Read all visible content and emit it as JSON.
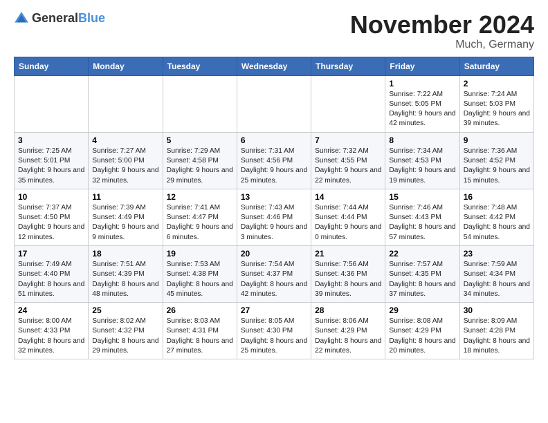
{
  "logo": {
    "general": "General",
    "blue": "Blue"
  },
  "title": "November 2024",
  "location": "Much, Germany",
  "weekdays": [
    "Sunday",
    "Monday",
    "Tuesday",
    "Wednesday",
    "Thursday",
    "Friday",
    "Saturday"
  ],
  "weeks": [
    [
      {
        "day": "",
        "info": ""
      },
      {
        "day": "",
        "info": ""
      },
      {
        "day": "",
        "info": ""
      },
      {
        "day": "",
        "info": ""
      },
      {
        "day": "",
        "info": ""
      },
      {
        "day": "1",
        "info": "Sunrise: 7:22 AM\nSunset: 5:05 PM\nDaylight: 9 hours and 42 minutes."
      },
      {
        "day": "2",
        "info": "Sunrise: 7:24 AM\nSunset: 5:03 PM\nDaylight: 9 hours and 39 minutes."
      }
    ],
    [
      {
        "day": "3",
        "info": "Sunrise: 7:25 AM\nSunset: 5:01 PM\nDaylight: 9 hours and 35 minutes."
      },
      {
        "day": "4",
        "info": "Sunrise: 7:27 AM\nSunset: 5:00 PM\nDaylight: 9 hours and 32 minutes."
      },
      {
        "day": "5",
        "info": "Sunrise: 7:29 AM\nSunset: 4:58 PM\nDaylight: 9 hours and 29 minutes."
      },
      {
        "day": "6",
        "info": "Sunrise: 7:31 AM\nSunset: 4:56 PM\nDaylight: 9 hours and 25 minutes."
      },
      {
        "day": "7",
        "info": "Sunrise: 7:32 AM\nSunset: 4:55 PM\nDaylight: 9 hours and 22 minutes."
      },
      {
        "day": "8",
        "info": "Sunrise: 7:34 AM\nSunset: 4:53 PM\nDaylight: 9 hours and 19 minutes."
      },
      {
        "day": "9",
        "info": "Sunrise: 7:36 AM\nSunset: 4:52 PM\nDaylight: 9 hours and 15 minutes."
      }
    ],
    [
      {
        "day": "10",
        "info": "Sunrise: 7:37 AM\nSunset: 4:50 PM\nDaylight: 9 hours and 12 minutes."
      },
      {
        "day": "11",
        "info": "Sunrise: 7:39 AM\nSunset: 4:49 PM\nDaylight: 9 hours and 9 minutes."
      },
      {
        "day": "12",
        "info": "Sunrise: 7:41 AM\nSunset: 4:47 PM\nDaylight: 9 hours and 6 minutes."
      },
      {
        "day": "13",
        "info": "Sunrise: 7:43 AM\nSunset: 4:46 PM\nDaylight: 9 hours and 3 minutes."
      },
      {
        "day": "14",
        "info": "Sunrise: 7:44 AM\nSunset: 4:44 PM\nDaylight: 9 hours and 0 minutes."
      },
      {
        "day": "15",
        "info": "Sunrise: 7:46 AM\nSunset: 4:43 PM\nDaylight: 8 hours and 57 minutes."
      },
      {
        "day": "16",
        "info": "Sunrise: 7:48 AM\nSunset: 4:42 PM\nDaylight: 8 hours and 54 minutes."
      }
    ],
    [
      {
        "day": "17",
        "info": "Sunrise: 7:49 AM\nSunset: 4:40 PM\nDaylight: 8 hours and 51 minutes."
      },
      {
        "day": "18",
        "info": "Sunrise: 7:51 AM\nSunset: 4:39 PM\nDaylight: 8 hours and 48 minutes."
      },
      {
        "day": "19",
        "info": "Sunrise: 7:53 AM\nSunset: 4:38 PM\nDaylight: 8 hours and 45 minutes."
      },
      {
        "day": "20",
        "info": "Sunrise: 7:54 AM\nSunset: 4:37 PM\nDaylight: 8 hours and 42 minutes."
      },
      {
        "day": "21",
        "info": "Sunrise: 7:56 AM\nSunset: 4:36 PM\nDaylight: 8 hours and 39 minutes."
      },
      {
        "day": "22",
        "info": "Sunrise: 7:57 AM\nSunset: 4:35 PM\nDaylight: 8 hours and 37 minutes."
      },
      {
        "day": "23",
        "info": "Sunrise: 7:59 AM\nSunset: 4:34 PM\nDaylight: 8 hours and 34 minutes."
      }
    ],
    [
      {
        "day": "24",
        "info": "Sunrise: 8:00 AM\nSunset: 4:33 PM\nDaylight: 8 hours and 32 minutes."
      },
      {
        "day": "25",
        "info": "Sunrise: 8:02 AM\nSunset: 4:32 PM\nDaylight: 8 hours and 29 minutes."
      },
      {
        "day": "26",
        "info": "Sunrise: 8:03 AM\nSunset: 4:31 PM\nDaylight: 8 hours and 27 minutes."
      },
      {
        "day": "27",
        "info": "Sunrise: 8:05 AM\nSunset: 4:30 PM\nDaylight: 8 hours and 25 minutes."
      },
      {
        "day": "28",
        "info": "Sunrise: 8:06 AM\nSunset: 4:29 PM\nDaylight: 8 hours and 22 minutes."
      },
      {
        "day": "29",
        "info": "Sunrise: 8:08 AM\nSunset: 4:29 PM\nDaylight: 8 hours and 20 minutes."
      },
      {
        "day": "30",
        "info": "Sunrise: 8:09 AM\nSunset: 4:28 PM\nDaylight: 8 hours and 18 minutes."
      }
    ]
  ]
}
